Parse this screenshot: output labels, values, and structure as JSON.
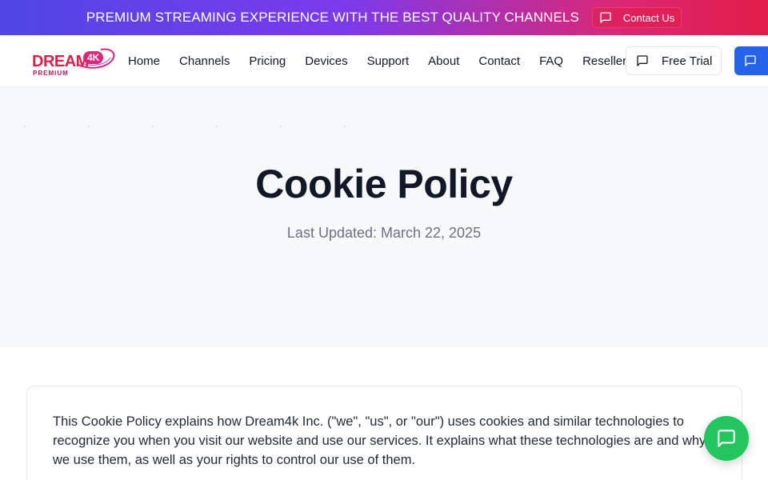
{
  "topbar": {
    "promo": "PREMIUM STREAMING EXPERIENCE WITH THE BEST QUALITY CHANNELS",
    "contact_label": "Contact Us",
    "gradient": [
      "#4f46e5",
      "#7c3aed",
      "#db2777",
      "#e11d48"
    ]
  },
  "brand": {
    "word": "DREAM",
    "badge": "4K",
    "sub": "PREMIUM",
    "color": "#e11d48"
  },
  "nav": {
    "links": [
      "Home",
      "Channels",
      "Pricing",
      "Devices",
      "Support",
      "About",
      "Contact",
      "FAQ",
      "Reseller"
    ],
    "free_trial_label": "Free Trial",
    "cta_color": "#2563eb"
  },
  "hero": {
    "title": "Cookie Policy",
    "updated": "Last Updated: March 22, 2025"
  },
  "content": {
    "intro": "This Cookie Policy explains how Dream4k Inc. (\"we\", \"us\", or \"our\") uses cookies and similar technologies to recognize you when you visit our website and use our services. It explains what these technologies are and why we use them, as well as your rights to control our use of them."
  },
  "chat_widget": {
    "icon": "message-square-icon",
    "color": "#22c55e"
  }
}
